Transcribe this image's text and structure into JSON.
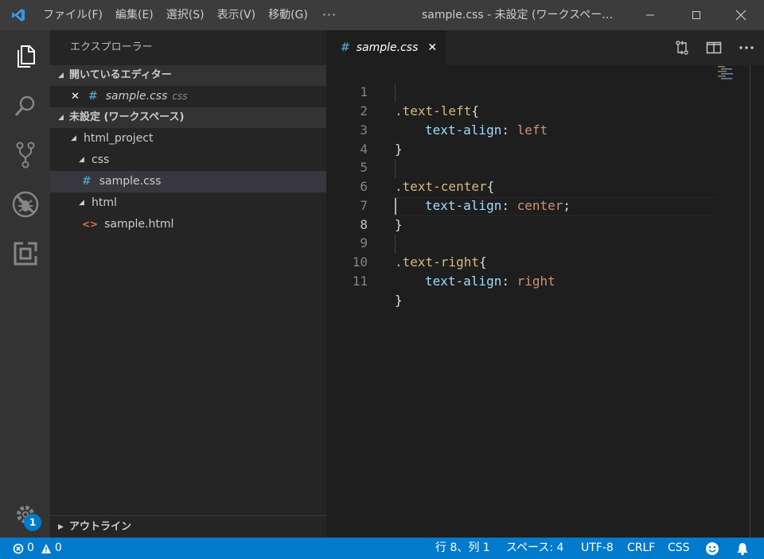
{
  "titlebar": {
    "menu": [
      "ファイル(F)",
      "編集(E)",
      "選択(S)",
      "表示(V)",
      "移動(G)"
    ],
    "more": "···",
    "window_title": "sample.css - 未設定 (ワークスペー…",
    "icons": [
      "vscode-logo-icon",
      "minimize-icon",
      "maximize-icon",
      "close-icon"
    ]
  },
  "activitybar": {
    "items": [
      "explorer-icon",
      "search-icon",
      "source-control-icon",
      "debug-icon",
      "extensions-icon"
    ],
    "settings_badge": "1"
  },
  "sidebar": {
    "title": "エクスプローラー",
    "open_editors": {
      "header": "開いているエディター",
      "items": [
        {
          "close": "✕",
          "icon": "#",
          "name": "sample.css",
          "desc": "css"
        }
      ]
    },
    "workspace": {
      "header": "未設定 (ワークスペース)",
      "tree": [
        {
          "label": "html_project"
        },
        {
          "label": "css"
        },
        {
          "icon": "#",
          "label": "sample.css"
        },
        {
          "label": "html"
        },
        {
          "icon": "<>",
          "label": "sample.html"
        }
      ]
    },
    "outline_header": "アウトライン"
  },
  "editor": {
    "tab": {
      "icon": "#",
      "label": "sample.css",
      "close": "✕"
    },
    "line_numbers": [
      "1",
      "2",
      "3",
      "4",
      "5",
      "6",
      "7",
      "8",
      "9",
      "10",
      "11"
    ],
    "active_line": "8",
    "lines": [
      {
        "selector": ".text-left",
        "brace": "{"
      },
      {
        "prop": "text-align",
        "colon": ": ",
        "value": "left",
        "semi": ""
      },
      {
        "brace": "}"
      },
      {},
      {
        "selector": ".text-center",
        "brace": "{"
      },
      {
        "prop": "text-align",
        "colon": ": ",
        "value": "center",
        "semi": ";"
      },
      {
        "brace": "}"
      },
      {},
      {
        "selector": ".text-right",
        "brace": "{"
      },
      {
        "prop": "text-align",
        "colon": ": ",
        "value": "right",
        "semi": ""
      },
      {
        "brace": "}"
      }
    ]
  },
  "statusbar": {
    "errors": "0",
    "warnings": "0",
    "position": "行 8、列 1",
    "spaces": "スペース: 4",
    "encoding": "UTF-8",
    "eol": "CRLF",
    "language": "CSS"
  },
  "colors": {
    "accent": "#007acc",
    "selector": "#d7ba7d",
    "property": "#9cdcfe",
    "value": "#ce9178",
    "css_icon": "#519aba",
    "html_icon": "#e37933"
  }
}
